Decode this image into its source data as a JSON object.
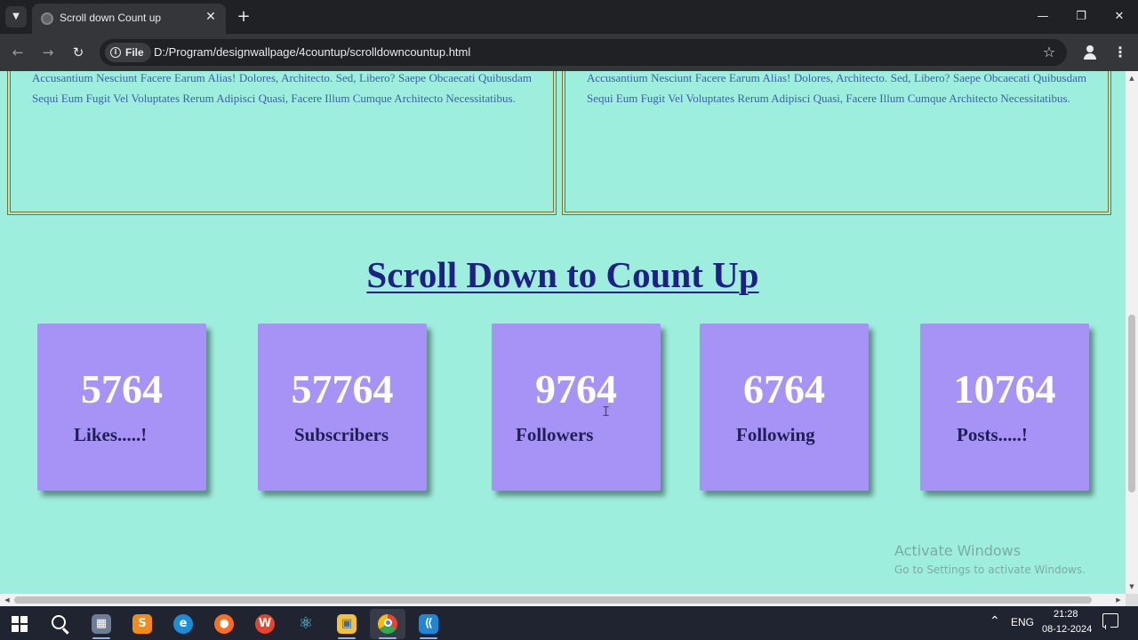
{
  "browser": {
    "tab_title": "Scroll down Count up",
    "site_chip_label": "File",
    "url": "D:/Program/designwallpage/4countup/scrolldowncountup.html"
  },
  "page": {
    "card_texts": [
      "Accusantium Nesciunt Facere Earum Alias! Dolores, Architecto. Sed, Libero? Saepe Obcaecati Quibusdam Sequi Eum Fugit Vel Voluptates Rerum Adipisci Quasi, Facere Illum Cumque Architecto Necessitatibus.",
      "Accusantium Nesciunt Facere Earum Alias! Dolores, Architecto. Sed, Libero? Saepe Obcaecati Quibusdam Sequi Eum Fugit Vel Voluptates Rerum Adipisci Quasi, Facere Illum Cumque Architecto Necessitatibus."
    ],
    "heading": "Scroll Down to Count Up",
    "stats": [
      {
        "value": "5764",
        "label": "Likes.....!"
      },
      {
        "value": "57764",
        "label": "Subscribers"
      },
      {
        "value": "9764",
        "label": "Followers"
      },
      {
        "value": "6764",
        "label": "Following"
      },
      {
        "value": "10764",
        "label": "Posts.....!"
      }
    ],
    "watermark": {
      "title": "Activate Windows",
      "subtitle": "Go to Settings to activate Windows."
    }
  },
  "taskbar": {
    "language": "ENG",
    "time": "21:28",
    "date": "08-12-2024",
    "apps": [
      "start-icon",
      "search-icon",
      "file-manager-icon",
      "sublime-text-icon",
      "edge-icon",
      "firefox-icon",
      "wps-office-icon",
      "react-icon",
      "file-explorer-icon",
      "chrome-icon",
      "vscode-icon"
    ]
  },
  "colors": {
    "page_background": "#9eeedd",
    "stat_box": "#a693f5",
    "heading": "#1f1f87",
    "card_border": "#8a6e1f",
    "card_text": "#3d5fa8"
  }
}
